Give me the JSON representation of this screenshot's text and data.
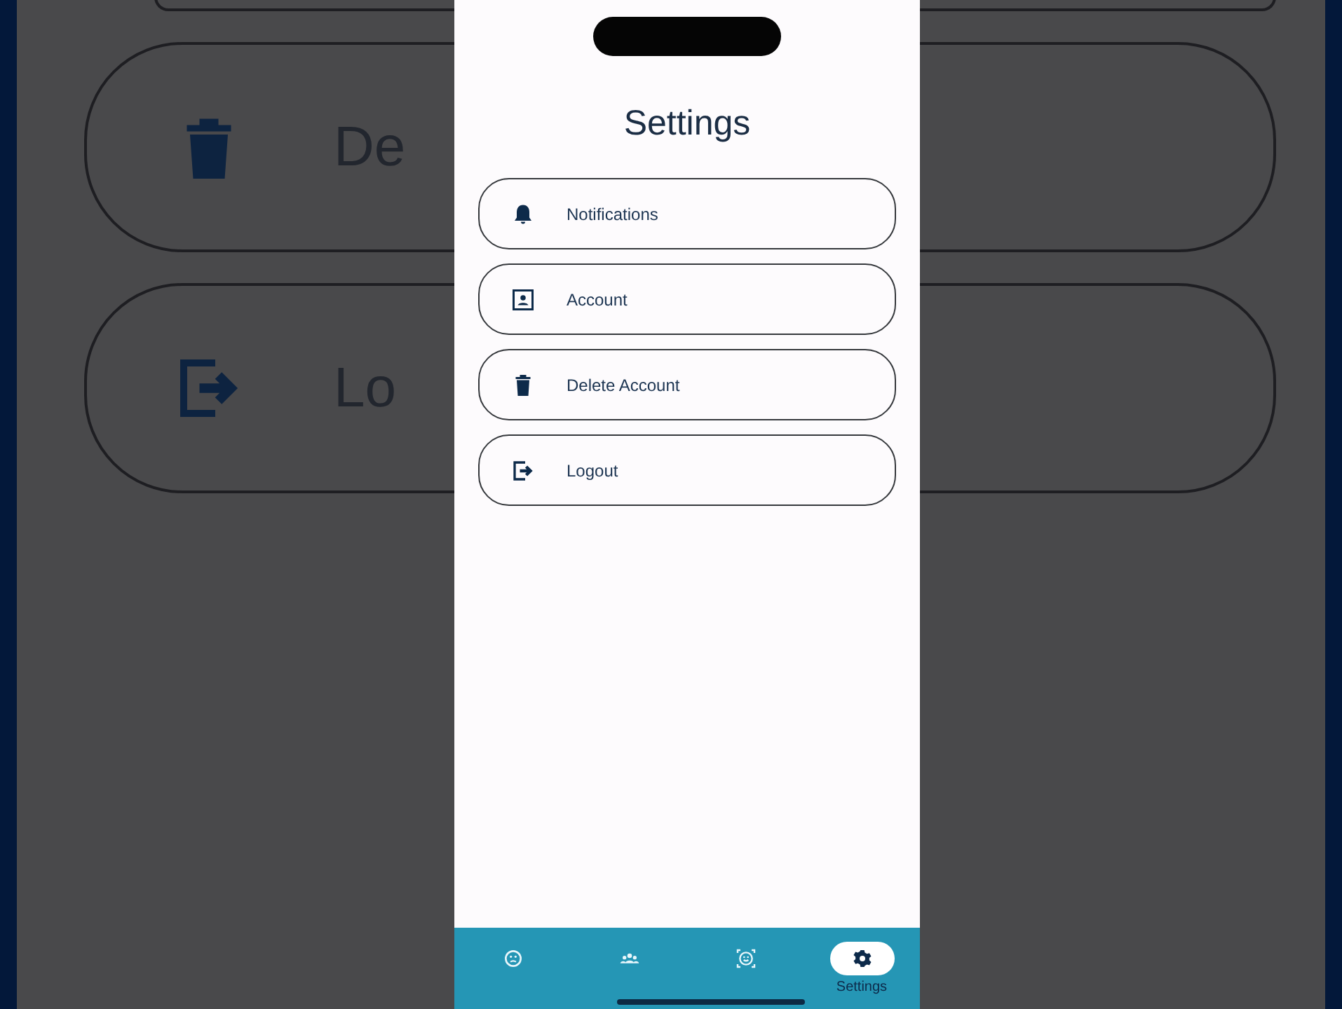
{
  "background": {
    "rows": [
      {
        "kind": "trash",
        "label": "De"
      },
      {
        "kind": "logout",
        "label": "Lo"
      }
    ]
  },
  "screen": {
    "title": "Settings",
    "items": [
      {
        "kind": "bell",
        "label": "Notifications"
      },
      {
        "kind": "contact",
        "label": "Account"
      },
      {
        "kind": "trash",
        "label": "Delete Account"
      },
      {
        "kind": "logout",
        "label": "Logout"
      }
    ]
  },
  "nav": [
    {
      "kind": "face",
      "selected": false
    },
    {
      "kind": "group",
      "selected": false
    },
    {
      "kind": "robot",
      "selected": false
    },
    {
      "kind": "gear",
      "label": "Settings",
      "selected": true
    }
  ]
}
